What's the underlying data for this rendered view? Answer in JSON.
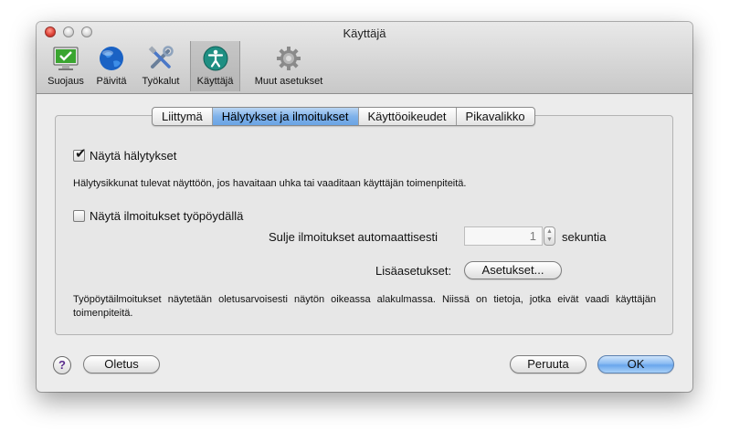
{
  "window": {
    "title": "Käyttäjä"
  },
  "toolbar": {
    "items": [
      {
        "label": "Suojaus",
        "icon": "monitor-check-icon"
      },
      {
        "label": "Päivitä",
        "icon": "globe-icon"
      },
      {
        "label": "Työkalut",
        "icon": "tools-icon"
      },
      {
        "label": "Käyttäjä",
        "icon": "accessibility-icon"
      },
      {
        "label": "Muut asetukset",
        "icon": "gear-icon"
      }
    ],
    "selected": "Käyttäjä"
  },
  "tabs": [
    {
      "label": "Liittymä"
    },
    {
      "label": "Hälytykset ja ilmoitukset"
    },
    {
      "label": "Käyttöoikeudet"
    },
    {
      "label": "Pikavalikko"
    }
  ],
  "active_tab": "Hälytykset ja ilmoitukset",
  "alerts": {
    "checkbox_label": "Näytä hälytykset",
    "checked": true,
    "description": "Hälytysikkunat tulevat näyttöön, jos havaitaan uhka tai vaaditaan käyttäjän toimenpiteitä."
  },
  "notifications": {
    "checkbox_label": "Näytä ilmoitukset työpöydällä",
    "checked": false,
    "autoclose_label": "Sulje ilmoitukset automaattisesti",
    "autoclose_value": "1",
    "autoclose_unit": "sekuntia",
    "advanced_label": "Lisäasetukset:",
    "advanced_button": "Asetukset...",
    "description": "Työpöytäilmoitukset näytetään oletusarvoisesti näytön oikeassa alakulmassa. Niissä on tietoja, jotka eivät vaadi käyttäjän toimenpiteitä."
  },
  "footer": {
    "help": "?",
    "default_button": "Oletus",
    "cancel_button": "Peruuta",
    "ok_button": "OK"
  },
  "colors": {
    "accent": "#6aa6ec",
    "close_button": "#e0453a",
    "help_glyph": "#5b2e8e"
  }
}
